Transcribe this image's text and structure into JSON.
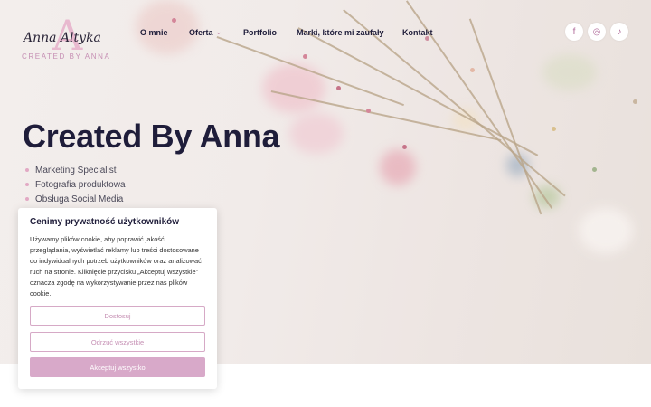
{
  "logo": {
    "mark": "A",
    "script": "Anna Altyka",
    "subtitle": "CREATED BY ANNA"
  },
  "nav": {
    "items": [
      {
        "label": "O mnie"
      },
      {
        "label": "Oferta",
        "caret": "⌄"
      },
      {
        "label": "Portfolio"
      },
      {
        "label": "Marki, które mi zaufały"
      },
      {
        "label": "Kontakt"
      }
    ]
  },
  "social": [
    {
      "icon": "facebook-icon",
      "glyph": "f"
    },
    {
      "icon": "instagram-icon",
      "glyph": "◎"
    },
    {
      "icon": "tiktok-icon",
      "glyph": "♪"
    }
  ],
  "hero": {
    "title": "Created By Anna",
    "bullets": [
      "Marketing Specialist",
      "Fotografia produktowa",
      "Obsługa Social Media"
    ]
  },
  "cookie": {
    "title": "Cenimy prywatność użytkowników",
    "text": "Używamy plików cookie, aby poprawić jakość przeglądania, wyświetlać reklamy lub treści dostosowane do indywidualnych potrzeb użytkowników oraz analizować ruch na stronie. Kliknięcie przycisku „Akceptuj wszystkie” oznacza zgodę na wykorzystywanie przez nas plików cookie.",
    "customize_label": "Dostosuj",
    "reject_label": "Odrzuć wszystkie",
    "accept_label": "Akceptuj wszystko"
  },
  "colors": {
    "navy": "#1f1d3a",
    "pink_accent": "#d8a9c9",
    "hero_bg": "#f1ebe9"
  }
}
